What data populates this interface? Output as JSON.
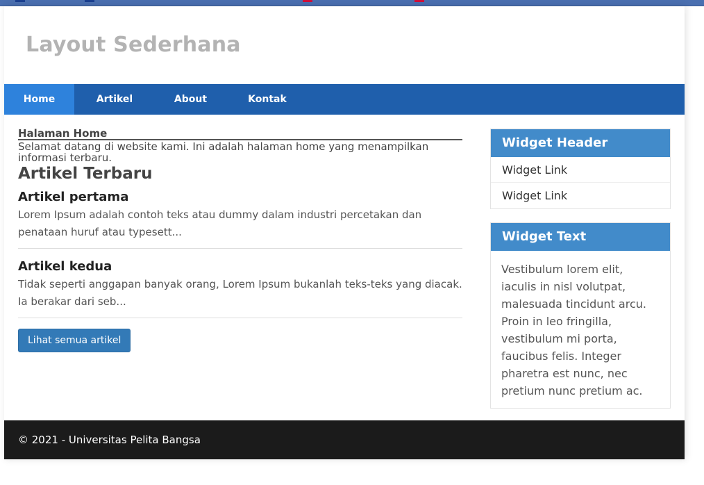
{
  "site": {
    "title": "Layout Sederhana"
  },
  "nav": {
    "items": [
      {
        "label": "Home"
      },
      {
        "label": "Artikel"
      },
      {
        "label": "About"
      },
      {
        "label": "Kontak"
      }
    ]
  },
  "main": {
    "page_heading": "Halaman Home",
    "welcome": "Selamat datang di website kami. Ini adalah halaman home yang menampilkan informasi terbaru.",
    "section_title": "Artikel Terbaru",
    "articles": [
      {
        "title": "Artikel pertama",
        "excerpt": "Lorem Ipsum adalah contoh teks atau dummy dalam industri percetakan dan penataan huruf atau typesett..."
      },
      {
        "title": "Artikel kedua",
        "excerpt": "Tidak seperti anggapan banyak orang, Lorem Ipsum bukanlah teks-teks yang diacak. Ia berakar dari seb..."
      }
    ],
    "button_label": "Lihat semua artikel"
  },
  "sidebar": {
    "widget_links": {
      "header": "Widget Header",
      "links": [
        "Widget Link",
        "Widget Link"
      ]
    },
    "widget_text": {
      "header": "Widget Text",
      "body": "Vestibulum lorem elit, iaculis in nisl volutpat, malesuada tincidunt arcu. Proin in leo fringilla, vestibulum mi porta, faucibus felis. Integer pharetra est nunc, nec pretium nunc pretium ac."
    }
  },
  "footer": {
    "text": "© 2021 - Universitas Pelita Bangsa"
  },
  "colors": {
    "nav_bg": "#1f5fac",
    "nav_active": "#2e82dc",
    "widget_header": "#428bca",
    "button": "#337ab7",
    "footer_bg": "#1b1b1b"
  }
}
